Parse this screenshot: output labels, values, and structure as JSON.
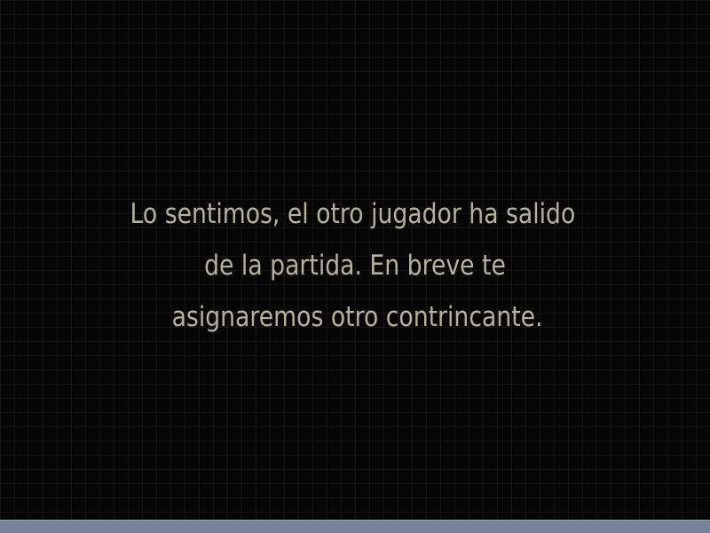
{
  "dialog": {
    "lines": [
      "Lo sentimos, el otro jugador ha salido",
      "de la partida. En breve te",
      "asignaremos otro contrincante."
    ]
  },
  "colors": {
    "background": "#050505",
    "brick_mortar": "#161616",
    "message_text": "#b6b19f",
    "bottom_bar": "#78839a"
  }
}
